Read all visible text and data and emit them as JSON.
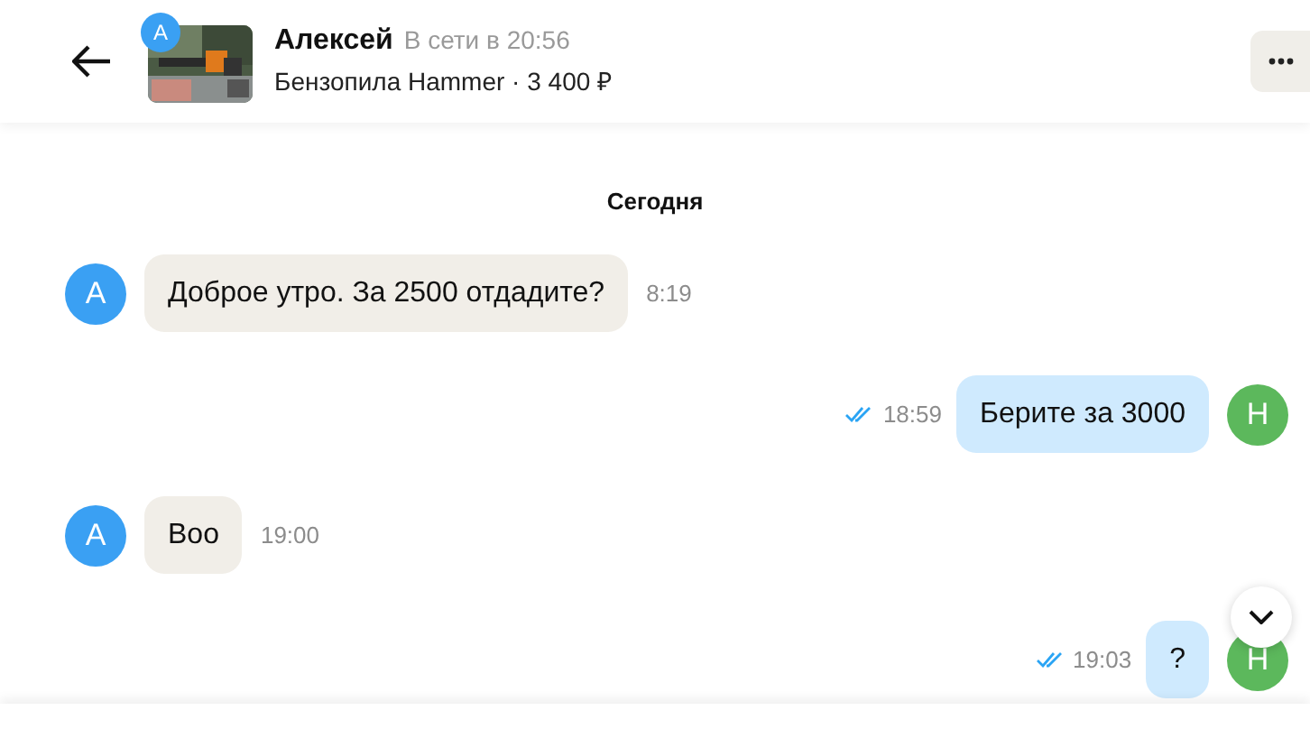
{
  "header": {
    "seller_avatar": "А",
    "name": "Алексей",
    "status": "В сети в 20:56",
    "listing": "Бензопила Hammer · 3 400 ₽"
  },
  "date_separator": "Сегодня",
  "messages": [
    {
      "kind": "incoming",
      "avatar": "А",
      "text": "Доброе утро. За 2500 отдадите?",
      "time": "8:19"
    },
    {
      "kind": "outgoing",
      "avatar": "Н",
      "text": "Берите за 3000",
      "time": "18:59",
      "read": true
    },
    {
      "kind": "incoming",
      "avatar": "А",
      "text": "Воо",
      "time": "19:00"
    },
    {
      "kind": "outgoing",
      "avatar": "Н",
      "text": "?",
      "time": "19:03",
      "read": true
    }
  ]
}
